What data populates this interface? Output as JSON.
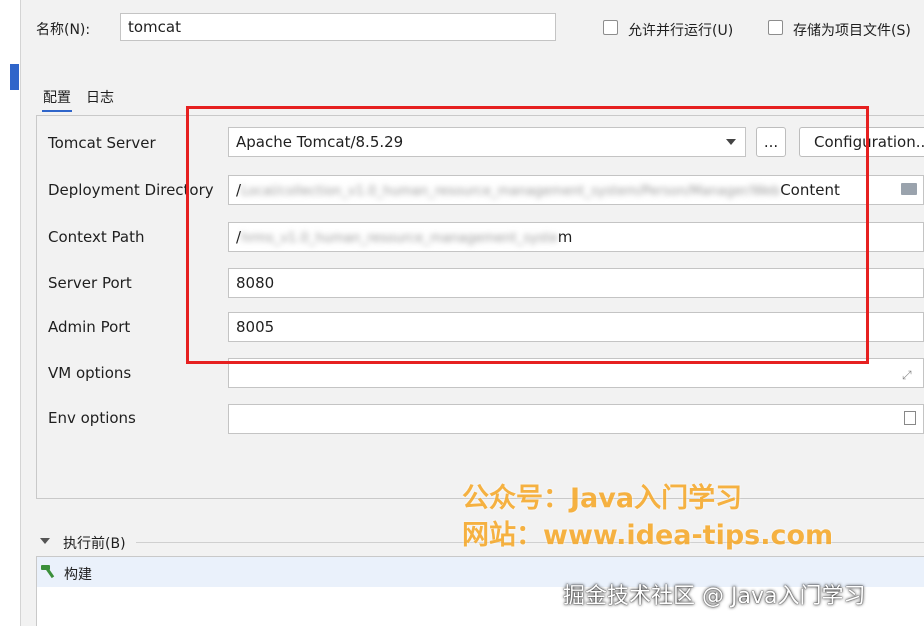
{
  "header": {
    "name_label": "名称(N):",
    "name_value": "tomcat",
    "allow_parallel_label": "允许并行运行(U)",
    "store_as_project_file_label": "存储为项目文件(S)"
  },
  "tabs": [
    {
      "label": "配置",
      "active": true
    },
    {
      "label": "日志",
      "active": false
    }
  ],
  "form": {
    "tomcat_server": {
      "label": "Tomcat Server",
      "value": "Apache Tomcat/8.5.29",
      "browse_label": "...",
      "configuration_label": "Configuration..."
    },
    "deployment_directory": {
      "label": "Deployment Directory",
      "prefix": "/",
      "blurred": "Local/collection_v1.0_human_resource_management_system/Person/Manager/Web",
      "suffix": "Content"
    },
    "context_path": {
      "label": "Context Path",
      "prefix": "/",
      "blurred": "hrms_v1.0_human_resource_management_syste",
      "suffix": "m"
    },
    "server_port": {
      "label": "Server Port",
      "value": "8080"
    },
    "admin_port": {
      "label": "Admin Port",
      "value": "8005"
    },
    "vm_options": {
      "label": "VM options",
      "value": ""
    },
    "env_options": {
      "label": "Env options",
      "value": ""
    }
  },
  "before_launch": {
    "label": "执行前(B)",
    "items": [
      {
        "label": "构建",
        "icon": "hammer-icon"
      }
    ]
  },
  "watermarks": {
    "line1": "公众号：Java入门学习",
    "line2": "网站：www.idea-tips.com",
    "line3": "掘金技术社区 @ Java入门学习"
  },
  "colors": {
    "highlight_box": "#e62020",
    "accent": "#2f65ca",
    "watermark": "#f6a623"
  }
}
